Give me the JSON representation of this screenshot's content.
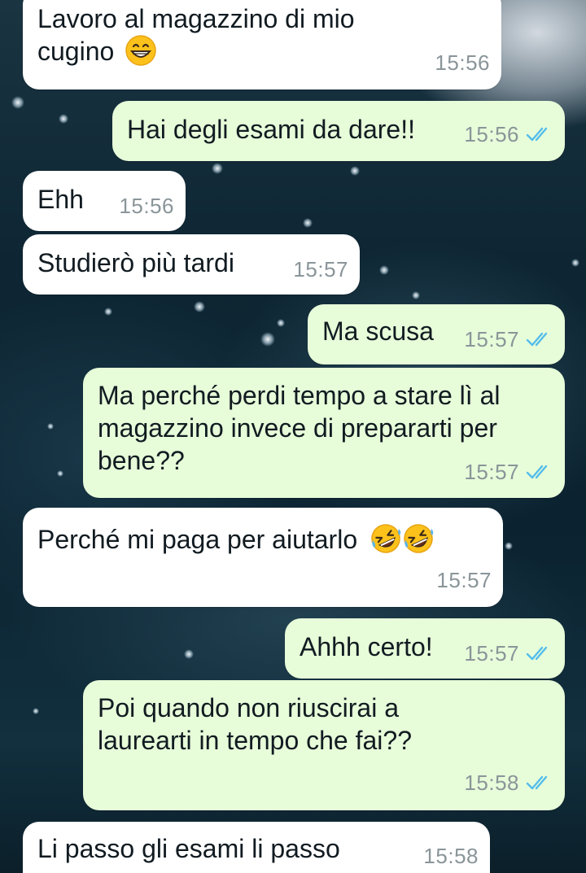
{
  "colors": {
    "incoming_bubble": "#ffffff",
    "outgoing_bubble": "#e7fcd9",
    "timestamp": "#8a9599",
    "read_ticks": "#53bdeb"
  },
  "messages": [
    {
      "direction": "in",
      "text": "Lavoro al magazzino di mio\ncugino",
      "emoji": "grinning-face-emoji",
      "time": "15:56"
    },
    {
      "direction": "out",
      "text": "Hai degli esami da dare!!",
      "time": "15:56",
      "status": "read"
    },
    {
      "direction": "in",
      "text": "Ehh",
      "time": "15:56"
    },
    {
      "direction": "in",
      "text": "Studierò più tardi",
      "time": "15:57"
    },
    {
      "direction": "out",
      "text": "Ma scusa",
      "time": "15:57",
      "status": "read"
    },
    {
      "direction": "out",
      "text": "Ma perché perdi tempo a stare lì al\nmagazzino invece di prepararti per\nbene??",
      "time": "15:57",
      "status": "read"
    },
    {
      "direction": "in",
      "text": "Perché mi paga per aiutarlo",
      "emoji": "rolling-on-floor-laughing-emoji",
      "emoji_count": 2,
      "time": "15:57"
    },
    {
      "direction": "out",
      "text": "Ahhh certo!",
      "time": "15:57",
      "status": "read"
    },
    {
      "direction": "out",
      "text": "Poi quando non riuscirai a\nlaurearti in tempo che fai??",
      "time": "15:58",
      "status": "read"
    },
    {
      "direction": "in",
      "text": "Li passo gli esami li passo",
      "time": "15:58"
    }
  ]
}
